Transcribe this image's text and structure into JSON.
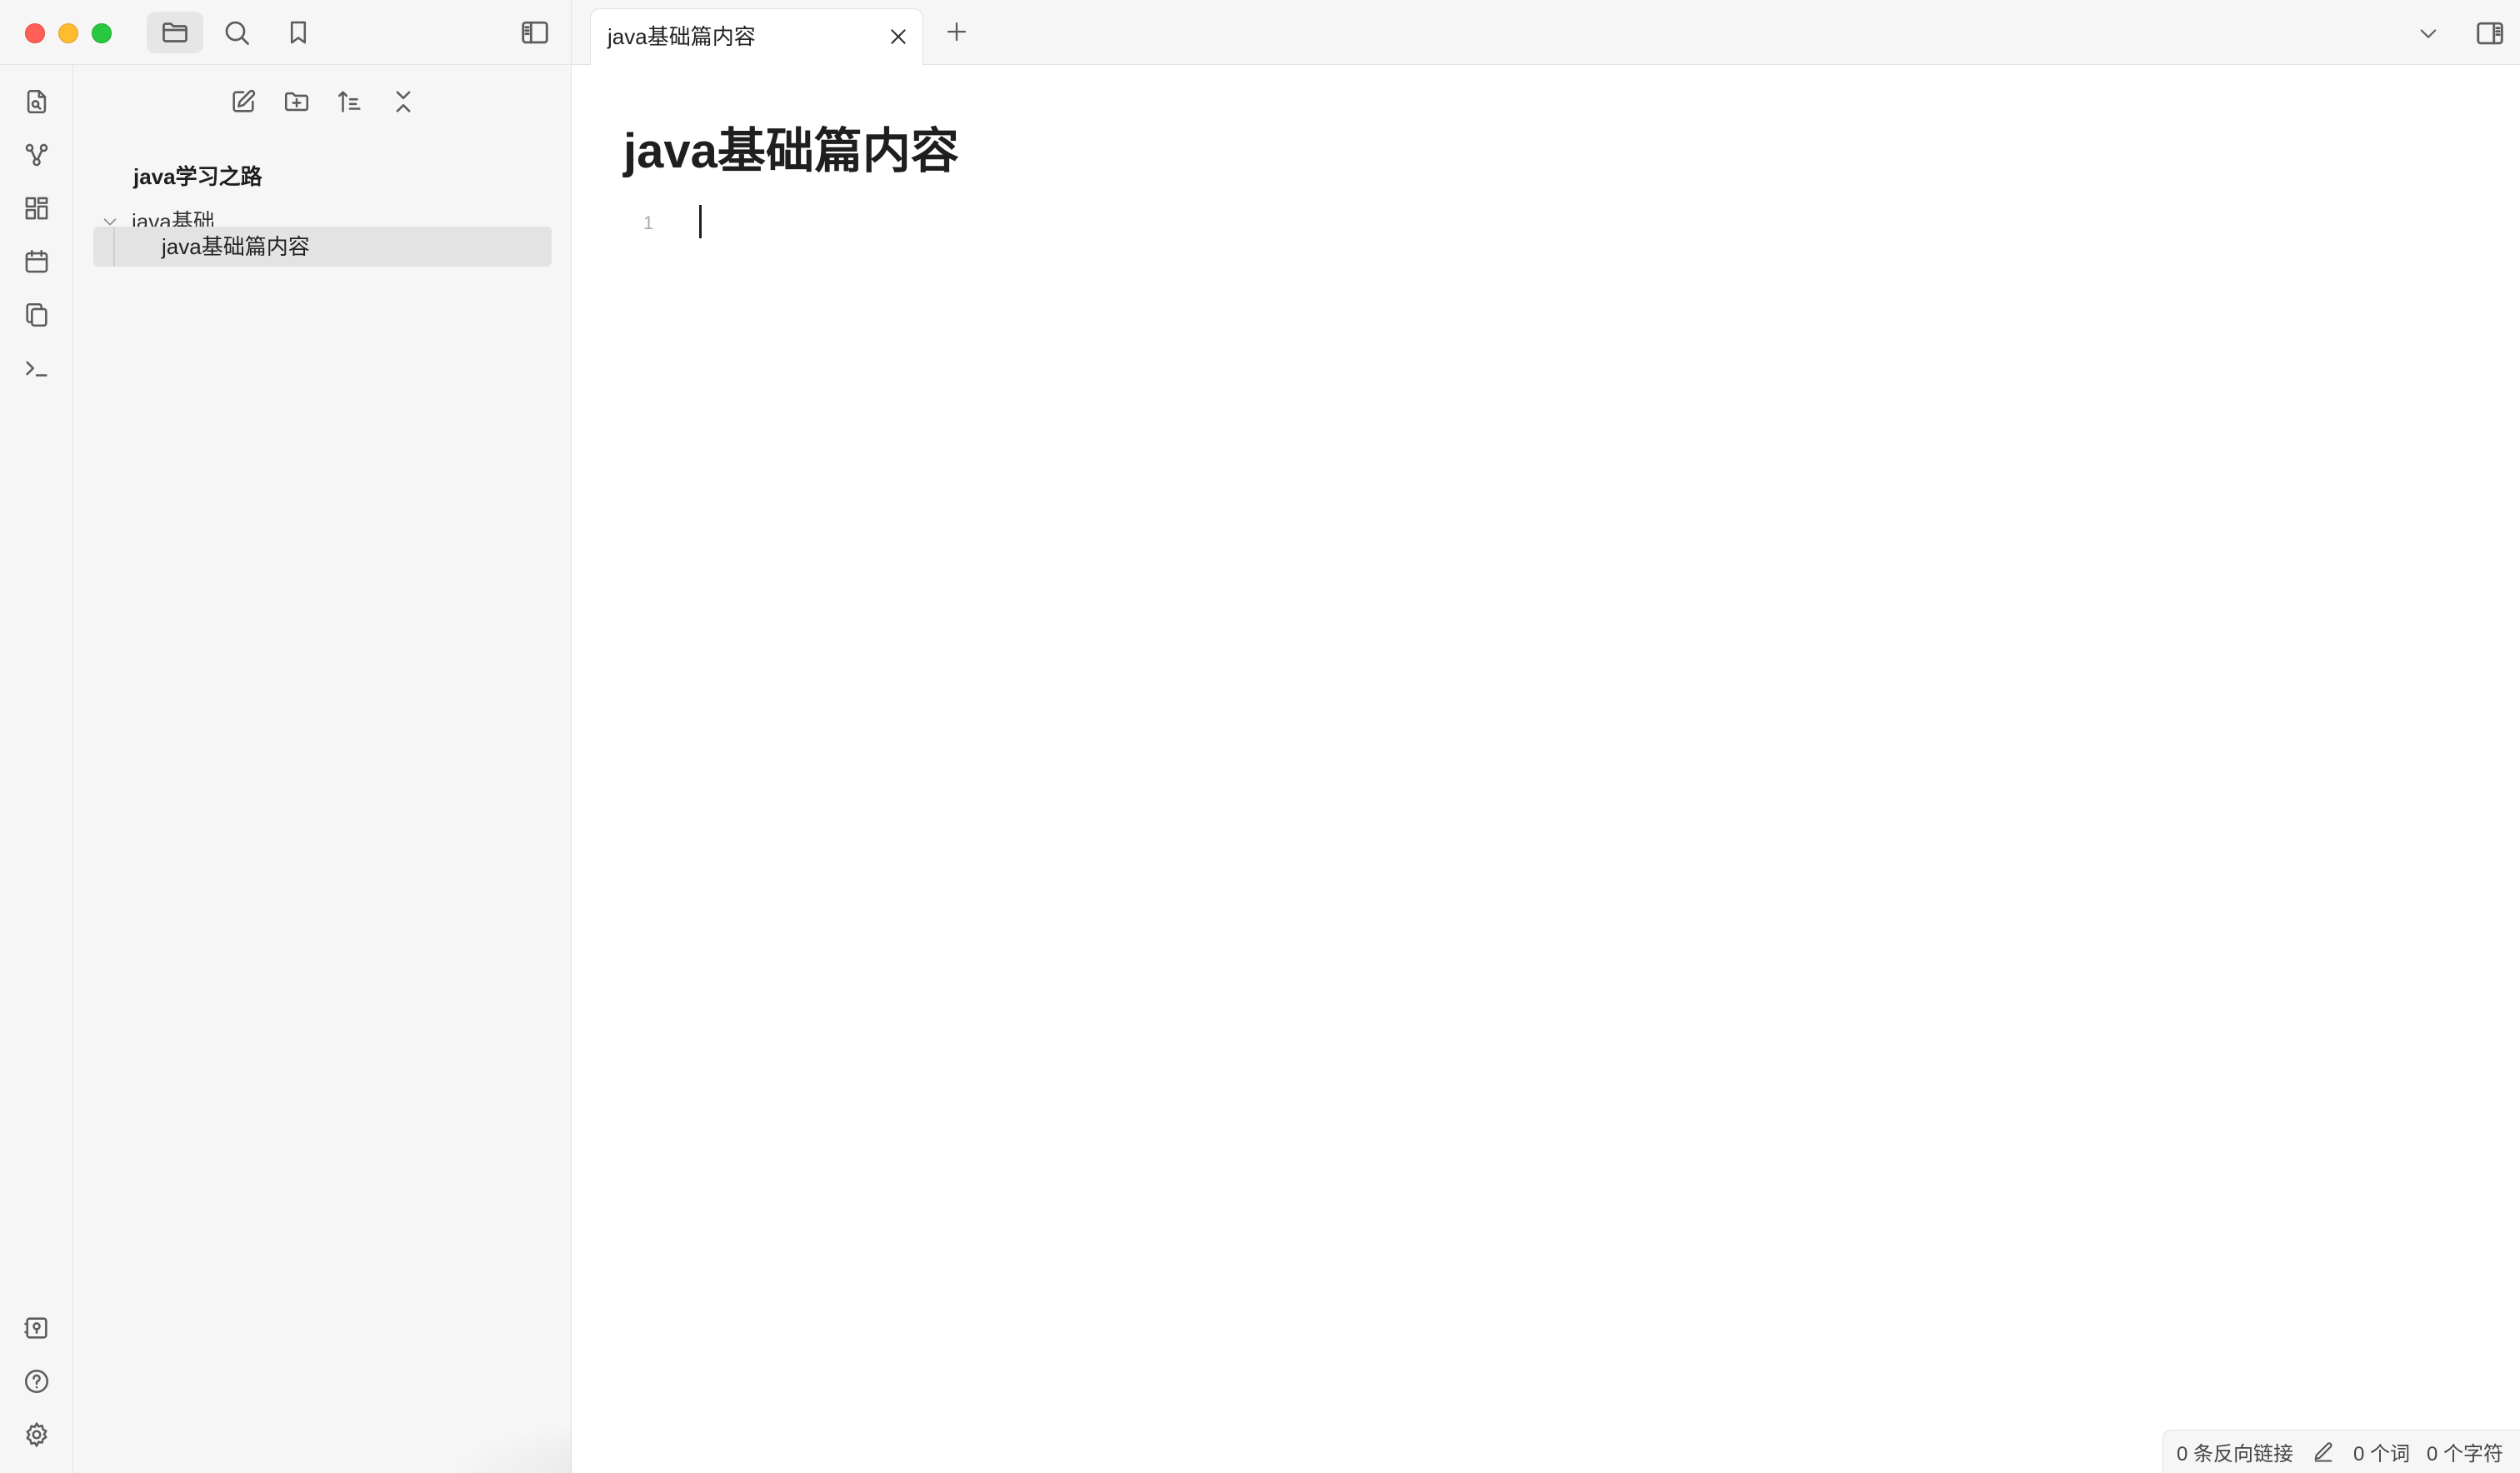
{
  "window": {
    "controls": [
      "close",
      "minimize",
      "maximize"
    ]
  },
  "topbar": {
    "icons": [
      "folder-icon",
      "search-icon",
      "bookmark-icon",
      "sidebar-left-icon"
    ]
  },
  "ribbon": {
    "icons": [
      "quick-switcher-icon",
      "graph-view-icon",
      "canvas-icon",
      "daily-note-icon",
      "templates-icon",
      "command-palette-icon",
      "vault-icon",
      "help-icon",
      "settings-icon"
    ]
  },
  "explorer": {
    "actions": [
      "new-note-icon",
      "new-folder-icon",
      "sort-icon",
      "collapse-all-icon"
    ],
    "vault_name": "java学习之路",
    "folder": {
      "name": "java基础",
      "expanded": true
    },
    "active_file": "java基础篇内容"
  },
  "tabs": {
    "active_title": "java基础篇内容"
  },
  "editor": {
    "title": "java基础篇内容",
    "line_number": "1"
  },
  "status": {
    "backlinks": "0 条反向链接",
    "words": "0 个词",
    "chars": "0 个字符"
  },
  "colors": {
    "chrome_bg": "#f6f6f6",
    "selected_item_bg": "#e3e3e3",
    "traffic_close": "#ff5f57",
    "traffic_min": "#febc2e",
    "traffic_max": "#28c840"
  }
}
